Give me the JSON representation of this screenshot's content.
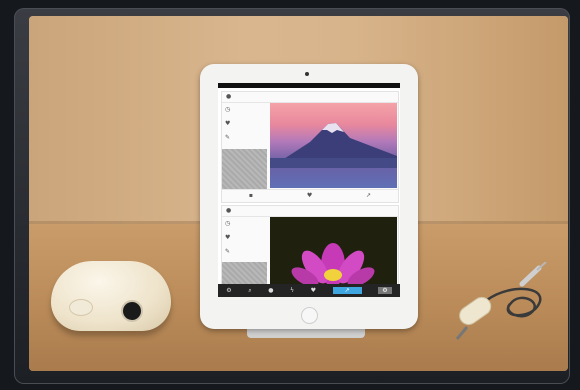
{
  "scene": {
    "description_alt": "",
    "app_screen": {
      "card1": {
        "user_icon": "user-icon",
        "username": "",
        "timestamp": "",
        "like_count": "",
        "edit_count": ""
      },
      "card2": {
        "user_icon": "user-icon",
        "username": "",
        "timestamp": ""
      },
      "tabbar_icons": [
        "settings-icon",
        "search-icon",
        "user-icon",
        "bolt-icon",
        "heart-icon",
        "share-icon",
        "gear-icon"
      ]
    }
  }
}
